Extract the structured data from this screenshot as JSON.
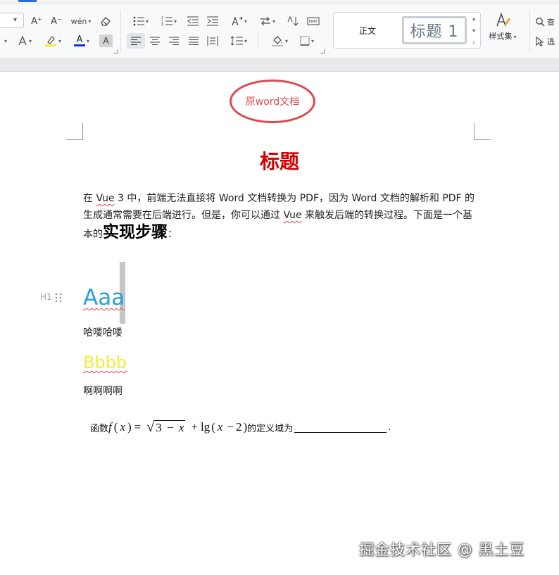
{
  "toolbar": {
    "font_row1": [
      "increase-font-size",
      "decrease-font-size",
      "phonetic-guide",
      "clear-formatting"
    ],
    "font_row2": [
      "text-effects",
      "highlight-color",
      "font-color",
      "character-shading"
    ],
    "increase_font_glyph": "A⁺",
    "decrease_font_glyph": "A⁻",
    "phonetic_glyph": "wén",
    "font_color_glyph": "A",
    "highlight_color": "#f4ec39",
    "font_color": "#1431c8",
    "shading_glyph": "A",
    "styles": {
      "normal_label": "正文",
      "heading1_label": "标题 1"
    },
    "style_set_label": "样式集",
    "find_label": "查",
    "select_label": "选"
  },
  "document": {
    "stamp_text": "原word文档",
    "title": "标题",
    "paragraph": {
      "part1": "在 ",
      "vue1": "Vue",
      "part2": " 3 中，前端无法直接将 Word 文档转换为 PDF，因为 Word 文档的解析和 PDF 的生成通常需要在后端进行。但是，你可以通过 ",
      "vue2": "Vue",
      "part3": " 来触发后端的转换过程。下面是一个基本的",
      "big": "实现步骤",
      "part4": "："
    },
    "heading_marker": "H1",
    "heading_text": "Aaa",
    "line1": "哈喽哈喽",
    "heading2_text": "Bbbb",
    "line2": "啊啊啊啊",
    "formula": {
      "prefix": "函数",
      "f": "f",
      "open1": "(",
      "x1": "x",
      "close1": ")",
      "eq": "=",
      "radicand_3": "3",
      "radicand_minus": "−",
      "radicand_x": "x",
      "plus": "+",
      "lg": "lg",
      "open2": "(",
      "x2": "x",
      "minus2": "−",
      "two": "2",
      "close2": ")",
      "suffix": "的定义域为",
      "end": "."
    },
    "colors": {
      "title": "#d40000",
      "heading": "#2aa0d6",
      "heading2": "#f4ec39",
      "stamp": "#e0474c"
    }
  },
  "watermark": "掘金技术社区 @ 黑土豆"
}
